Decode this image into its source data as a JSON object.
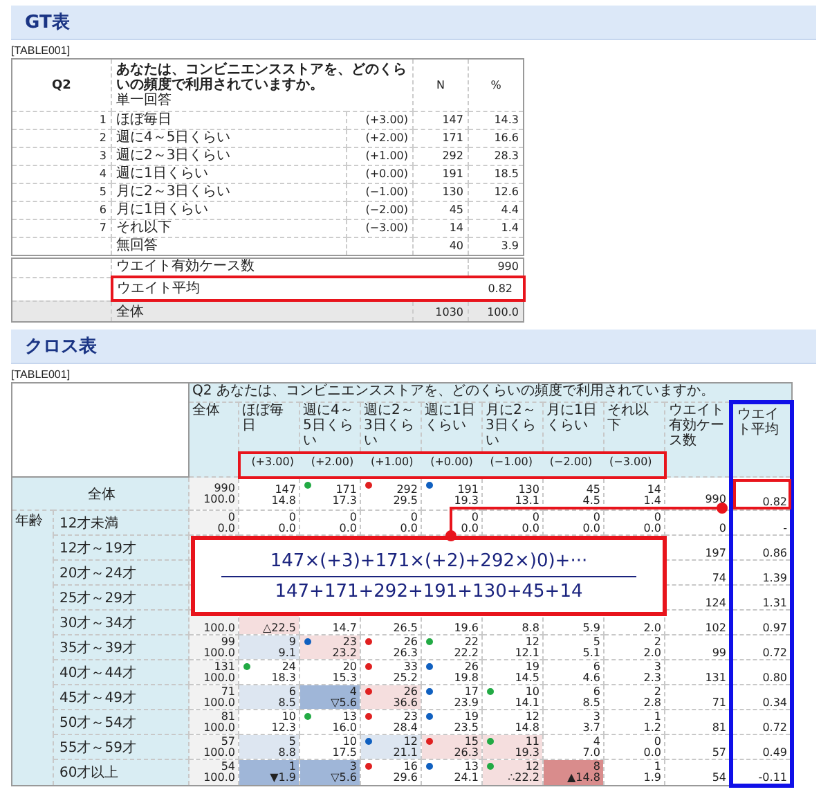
{
  "gt": {
    "heading": "GT表",
    "table_id": "[TABLE001]",
    "question_no": "Q2",
    "question": "あなたは、コンビニエンスストアを、どのくらいの頻度で利用されていますか。",
    "answer_type": "単一回答",
    "n_header": "N",
    "pct_header": "%",
    "options": [
      {
        "no": "1",
        "label": "ほぼ毎日",
        "weight": "(+3.00)",
        "n": "147",
        "pct": "14.3"
      },
      {
        "no": "2",
        "label": "週に4～5日くらい",
        "weight": "(+2.00)",
        "n": "171",
        "pct": "16.6"
      },
      {
        "no": "3",
        "label": "週に2～3日くらい",
        "weight": "(+1.00)",
        "n": "292",
        "pct": "28.3"
      },
      {
        "no": "4",
        "label": "週に1日くらい",
        "weight": "(+0.00)",
        "n": "191",
        "pct": "18.5"
      },
      {
        "no": "5",
        "label": "月に2～3日くらい",
        "weight": "(−1.00)",
        "n": "130",
        "pct": "12.6"
      },
      {
        "no": "6",
        "label": "月に1日くらい",
        "weight": "(−2.00)",
        "n": "45",
        "pct": "4.4"
      },
      {
        "no": "7",
        "label": "それ以下",
        "weight": "(−3.00)",
        "n": "14",
        "pct": "1.4"
      }
    ],
    "no_answer": {
      "label": "無回答",
      "n": "40",
      "pct": "3.9"
    },
    "weight_cases": {
      "label": "ウエイト有効ケース数",
      "value": "990"
    },
    "weight_mean": {
      "label": "ウエイト平均",
      "value": "0.82"
    },
    "total": {
      "label": "全体",
      "n": "1030",
      "pct": "100.0"
    }
  },
  "cross": {
    "heading": "クロス表",
    "table_id": "[TABLE001]",
    "question": "Q2 あなたは、コンビニエンスストアを、どのくらいの頻度で利用されていますか。",
    "total_header": "全体",
    "options": [
      {
        "label": "ほぼ毎日",
        "weight": "(+3.00)"
      },
      {
        "label": "週に4～5日くらい",
        "weight": "(+2.00)"
      },
      {
        "label": "週に2～3日くらい",
        "weight": "(+1.00)"
      },
      {
        "label": "週に1日くらい",
        "weight": "(+0.00)"
      },
      {
        "label": "月に2～3日くらい",
        "weight": "(−1.00)"
      },
      {
        "label": "月に1日くらい",
        "weight": "(−2.00)"
      },
      {
        "label": "それ以下",
        "weight": "(−3.00)"
      }
    ],
    "weight_n_header": "ウエイト有効ケース数",
    "weight_mean_header": "ウエイト平均",
    "total_row": {
      "label": "全体",
      "n": "990",
      "pct": "100.0",
      "weight_n": "990",
      "weight_mean": "0.82",
      "cells": [
        {
          "n": "147",
          "pct": "14.8"
        },
        {
          "n": "171",
          "pct": "17.3",
          "dot": {
            "color": "#22aa44"
          }
        },
        {
          "n": "292",
          "pct": "29.5",
          "dot": {
            "color": "#e02020"
          }
        },
        {
          "n": "191",
          "pct": "19.3",
          "dot": {
            "color": "#1060c0"
          }
        },
        {
          "n": "130",
          "pct": "13.1"
        },
        {
          "n": "45",
          "pct": "4.5"
        },
        {
          "n": "14",
          "pct": "1.4"
        }
      ]
    },
    "group": "年齢",
    "rows": [
      {
        "label": "12才未満",
        "n": "0",
        "pct": "0.0",
        "weight_n": "0",
        "weight_mean": "-",
        "cells": [
          {
            "n": "0",
            "pct": "0.0"
          },
          {
            "n": "0",
            "pct": "0.0"
          },
          {
            "n": "0",
            "pct": "0.0"
          },
          {
            "n": "0",
            "pct": "0.0"
          },
          {
            "n": "0",
            "pct": "0.0"
          },
          {
            "n": "0",
            "pct": "0.0"
          },
          {
            "n": "0",
            "pct": "0.0"
          }
        ]
      },
      {
        "label": "12才～19才",
        "weight_n": "197",
        "weight_mean": "0.86"
      },
      {
        "label": "20才～24才",
        "weight_n": "74",
        "weight_mean": "1.39"
      },
      {
        "label": "25才～29才",
        "weight_n": "124",
        "weight_mean": "1.31"
      },
      {
        "label": "30才～34才",
        "pct": "100.0",
        "weight_n": "102",
        "weight_mean": "0.97",
        "cells": [
          {
            "pct": "△22.5",
            "fill": {
              "color": "#f5dede"
            }
          },
          {
            "pct": "14.7"
          },
          {
            "pct": "26.5"
          },
          {
            "pct": "19.6"
          },
          {
            "pct": "8.8"
          },
          {
            "pct": "5.9"
          },
          {
            "pct": "2.0"
          }
        ]
      },
      {
        "label": "35才～39才",
        "n": "99",
        "pct": "100.0",
        "weight_n": "99",
        "weight_mean": "0.72",
        "cells": [
          {
            "n": "9",
            "pct": "9.1",
            "fill": {
              "color": "#dde6f1"
            }
          },
          {
            "n": "23",
            "pct": "23.2",
            "fill": {
              "color": "#f5dede"
            },
            "dot": {
              "color": "#1060c0"
            }
          },
          {
            "n": "26",
            "pct": "26.3",
            "dot": {
              "color": "#e02020"
            }
          },
          {
            "n": "22",
            "pct": "22.2",
            "dot": {
              "color": "#22aa44"
            }
          },
          {
            "n": "12",
            "pct": "12.1"
          },
          {
            "n": "5",
            "pct": "5.1"
          },
          {
            "n": "2",
            "pct": "2.0"
          }
        ]
      },
      {
        "label": "40才～44才",
        "n": "131",
        "pct": "100.0",
        "weight_n": "131",
        "weight_mean": "0.80",
        "cells": [
          {
            "n": "24",
            "pct": "18.3",
            "dot": {
              "color": "#22aa44"
            }
          },
          {
            "n": "20",
            "pct": "15.3"
          },
          {
            "n": "33",
            "pct": "25.2",
            "dot": {
              "color": "#e02020"
            }
          },
          {
            "n": "26",
            "pct": "19.8",
            "dot": {
              "color": "#1060c0"
            }
          },
          {
            "n": "19",
            "pct": "14.5"
          },
          {
            "n": "6",
            "pct": "4.6"
          },
          {
            "n": "3",
            "pct": "2.3"
          }
        ]
      },
      {
        "label": "45才～49才",
        "n": "71",
        "pct": "100.0",
        "weight_n": "71",
        "weight_mean": "0.34",
        "cells": [
          {
            "n": "6",
            "pct": "8.5",
            "fill": {
              "color": "#dde6f1"
            }
          },
          {
            "n": "4",
            "pct": "▽5.6",
            "fill": {
              "color": "#9fb6d8"
            }
          },
          {
            "n": "26",
            "pct": "36.6",
            "fill": {
              "color": "#f5dede"
            },
            "dot": {
              "color": "#e02020"
            }
          },
          {
            "n": "17",
            "pct": "23.9",
            "dot": {
              "color": "#1060c0"
            }
          },
          {
            "n": "10",
            "pct": "14.1",
            "dot": {
              "color": "#22aa44"
            }
          },
          {
            "n": "6",
            "pct": "8.5"
          },
          {
            "n": "2",
            "pct": "2.8"
          }
        ]
      },
      {
        "label": "50才～54才",
        "n": "81",
        "pct": "100.0",
        "weight_n": "81",
        "weight_mean": "0.72",
        "cells": [
          {
            "n": "10",
            "pct": "12.3"
          },
          {
            "n": "13",
            "pct": "16.0",
            "dot": {
              "color": "#22aa44"
            }
          },
          {
            "n": "23",
            "pct": "28.4",
            "dot": {
              "color": "#e02020"
            }
          },
          {
            "n": "19",
            "pct": "23.5",
            "dot": {
              "color": "#1060c0"
            }
          },
          {
            "n": "12",
            "pct": "14.8"
          },
          {
            "n": "3",
            "pct": "3.7"
          },
          {
            "n": "1",
            "pct": "1.2"
          }
        ]
      },
      {
        "label": "55才～59才",
        "n": "57",
        "pct": "100.0",
        "weight_n": "57",
        "weight_mean": "0.49",
        "cells": [
          {
            "n": "5",
            "pct": "8.8",
            "fill": {
              "color": "#dde6f1"
            }
          },
          {
            "n": "10",
            "pct": "17.5"
          },
          {
            "n": "12",
            "pct": "21.1",
            "fill": {
              "color": "#dde6f1"
            },
            "dot": {
              "color": "#1060c0"
            }
          },
          {
            "n": "15",
            "pct": "26.3",
            "fill": {
              "color": "#f5dede"
            },
            "dot": {
              "color": "#e02020"
            }
          },
          {
            "n": "11",
            "pct": "19.3",
            "fill": {
              "color": "#f5dede"
            },
            "dot": {
              "color": "#22aa44"
            }
          },
          {
            "n": "4",
            "pct": "7.0"
          },
          {
            "n": "0",
            "pct": "0.0"
          }
        ]
      },
      {
        "label": "60才以上",
        "n": "54",
        "pct": "100.0",
        "weight_n": "54",
        "weight_mean": "-0.11",
        "cells": [
          {
            "n": "1",
            "pct": "▼1.9",
            "fill": {
              "color": "#9fb6d8"
            }
          },
          {
            "n": "3",
            "pct": "▽5.6",
            "fill": {
              "color": "#9fb6d8"
            }
          },
          {
            "n": "16",
            "pct": "29.6",
            "dot": {
              "color": "#e02020"
            }
          },
          {
            "n": "13",
            "pct": "24.1",
            "dot": {
              "color": "#1060c0"
            }
          },
          {
            "n": "12",
            "pct": "∴22.2",
            "fill": {
              "color": "#f5dede"
            },
            "dot": {
              "color": "#22aa44"
            }
          },
          {
            "n": "8",
            "pct": "▲14.8",
            "fill": {
              "color": "#d98c8c"
            }
          },
          {
            "n": "1",
            "pct": "1.9"
          }
        ]
      }
    ],
    "formula": {
      "numerator": "147×(+3)+171×(+2)+292×)0)+···",
      "denominator": "147+171+292+191+130+45+14"
    }
  }
}
